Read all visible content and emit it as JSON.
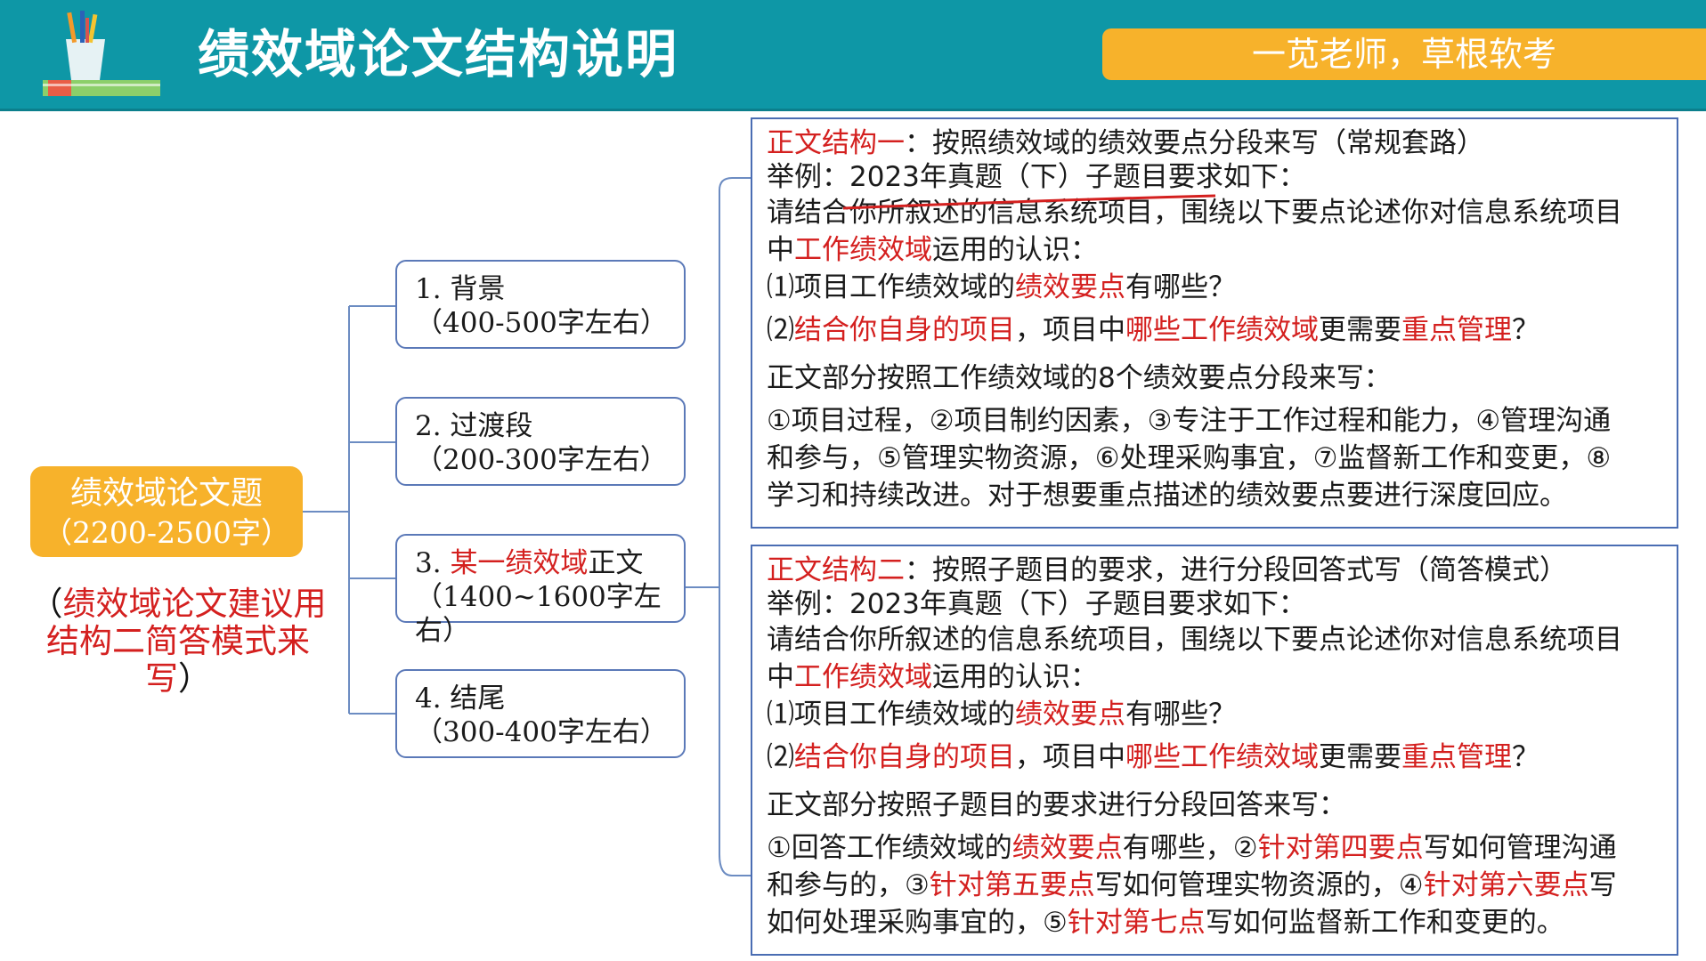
{
  "header": {
    "title": "绩效域论文结构说明",
    "badge": "一苋老师，草根软考"
  },
  "colors": {
    "header_bg": "#0e97a6",
    "accent_orange": "#f7b22b",
    "emphasis_red": "#d4201f",
    "border_blue": "#4a6db3"
  },
  "icons": {
    "logo": "pencil-cup-on-books-icon"
  },
  "root": {
    "line1": "绩效域论文题",
    "line2": "（2200-2500字）"
  },
  "note": {
    "open": "（",
    "line1": "绩效域论文建议用",
    "line2": "结构二简答模式来写",
    "close": "）"
  },
  "nodes": [
    {
      "line1": "1. 背景",
      "line2": "（400-500字左右）"
    },
    {
      "line1": "2. 过渡段",
      "line2": "（200-300字左右）"
    },
    {
      "prefix": "3. ",
      "red": "某一绩效域",
      "suffix": "正文",
      "line2": "（1400~1600字左右）"
    },
    {
      "line1": "4. 结尾",
      "line2": "（300-400字左右）"
    }
  ],
  "panel1": {
    "h_red": "正文结构一",
    "h_rest": "：按照绩效域的绩效要点分段来写（常规套路）",
    "example": "举例：2023年真题（下）子题目要求如下：",
    "q_intro": "请结合你所叙述的信息系统项目，围绕以下要点论述你对信息系统项目",
    "q2_a": "中",
    "q2_red": "工作绩效域",
    "q2_b": "运用的认识：",
    "q3_a": "⑴项目工作绩效域的",
    "q3_red": "绩效要点",
    "q3_b": "有哪些？",
    "q4_a": "⑵",
    "q4_red1": "结合你自身的项目",
    "q4_b": "，项目中",
    "q4_red2": "哪些工作绩效域",
    "q4_c": "更需要",
    "q4_red3": "重点管理",
    "q4_d": "？",
    "section": "正文部分按照工作绩效域的8个绩效要点分段来写：",
    "p1": "①项目过程，②项目制约因素，③专注于工作过程和能力，④管理沟通",
    "p2": "和参与，⑤管理实物资源，⑥处理采购事宜，⑦监督新工作和变更，⑧",
    "p3": "学习和持续改进。对于想要重点描述的绩效要点要进行深度回应。"
  },
  "panel2": {
    "h_red": "正文结构二",
    "h_rest": "：按照子题目的要求，进行分段回答式写（简答模式）",
    "example": "举例：2023年真题（下）子题目要求如下：",
    "q_intro": "请结合你所叙述的信息系统项目，围绕以下要点论述你对信息系统项目",
    "q2_a": "中",
    "q2_red": "工作绩效域",
    "q2_b": "运用的认识：",
    "q3_a": "⑴项目工作绩效域的",
    "q3_red": "绩效要点",
    "q3_b": "有哪些？",
    "q4_a": "⑵",
    "q4_red1": "结合你自身的项目",
    "q4_b": "，项目中",
    "q4_red2": "哪些工作绩效域",
    "q4_c": "更需要",
    "q4_red3": "重点管理",
    "q4_d": "？",
    "section": "正文部分按照子题目的要求进行分段回答来写：",
    "r1_a": "①回答工作绩效域的",
    "r1_red1": "绩效要点",
    "r1_b": "有哪些，②",
    "r1_red2": "针对第四要点",
    "r1_c": "写如何管理沟通",
    "r2_a": "和参与的，③",
    "r2_red1": "针对第五要点",
    "r2_b": "写如何管理实物资源的，④",
    "r2_red2": "针对第六要点",
    "r2_c": "写",
    "r3_a": "如何处理采购事宜的，⑤",
    "r3_red": "针对第七点",
    "r3_b": "写如何监督新工作和变更的。"
  }
}
